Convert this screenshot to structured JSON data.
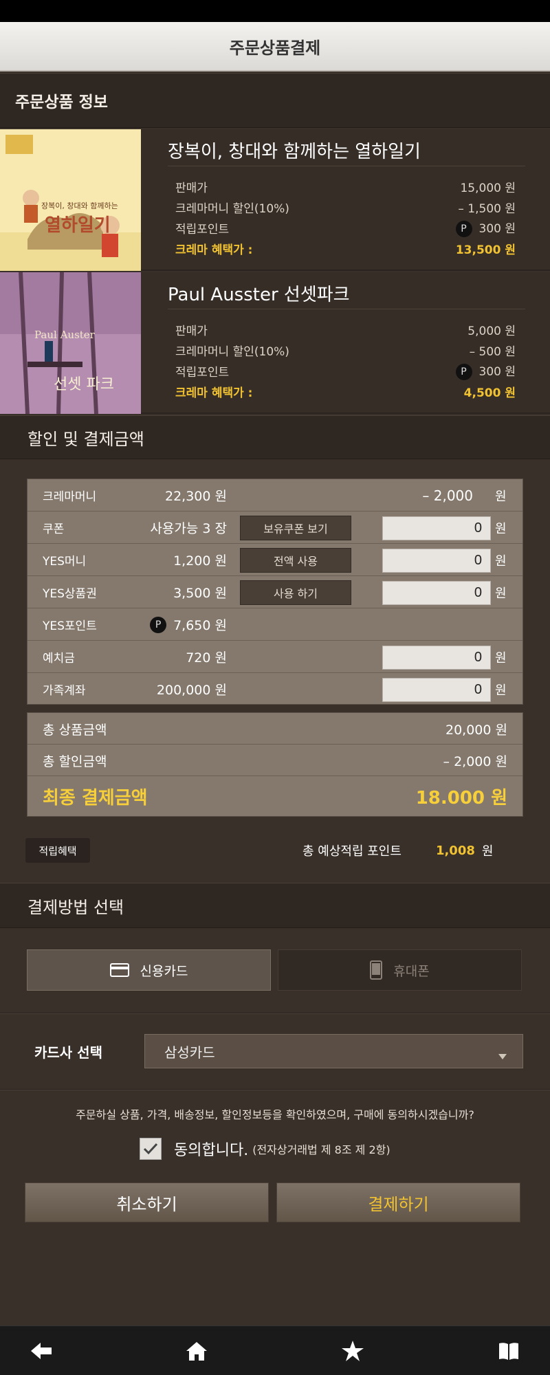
{
  "header": {
    "title": "주문상품결제"
  },
  "order_info": {
    "section_title": "주문상품 정보",
    "products": [
      {
        "name": "장복이, 창대와 함께하는 열하일기",
        "cover_title": "열하일기",
        "cover_subtitle": "장복이, 창대와 함께하는",
        "rows": [
          {
            "label": "판매가",
            "value": "15,000 원"
          },
          {
            "label": "크레마머니 할인(10%)",
            "value": "– 1,500 원"
          },
          {
            "label": "적립포인트",
            "value": "300 원",
            "badge": "P"
          },
          {
            "label": "크레마 혜택가 :",
            "value": "13,500 원"
          }
        ]
      },
      {
        "name": "Paul Ausster 선셋파크",
        "cover_title": "선셋 파크",
        "cover_subtitle": "Paul Auster",
        "rows": [
          {
            "label": "판매가",
            "value": "5,000 원"
          },
          {
            "label": "크레마머니 할인(10%)",
            "value": "– 500 원"
          },
          {
            "label": "적립포인트",
            "value": "300 원",
            "badge": "P"
          },
          {
            "label": "크레마 혜택가 :",
            "value": "4,500 원"
          }
        ]
      }
    ]
  },
  "discount": {
    "section_title": "할인 및 결제금액",
    "rows": [
      {
        "label": "크레마머니",
        "balance": "22,300 원",
        "discount": "– 2,000",
        "unit": "원"
      },
      {
        "label": "쿠폰",
        "balance": "사용가능 3 장",
        "button": "보유쿠폰 보기",
        "input": "0",
        "unit": "원"
      },
      {
        "label": "YES머니",
        "balance": "1,200 원",
        "button": "전액 사용",
        "input": "0",
        "unit": "원"
      },
      {
        "label": "YES상품권",
        "balance": "3,500 원",
        "button": "사용 하기",
        "input": "0",
        "unit": "원"
      },
      {
        "label": "YES포인트",
        "balance": "7,650 원",
        "badge": "P"
      },
      {
        "label": "예치금",
        "balance": "720 원",
        "input": "0",
        "unit": "원"
      },
      {
        "label": "가족계좌",
        "balance": "200,000 원",
        "input": "0",
        "unit": "원"
      }
    ],
    "summary": {
      "total_label": "총 상품금액",
      "total_value": "20,000 원",
      "discount_label": "총 할인금액",
      "discount_value": "– 2,000 원",
      "final_label": "최종 결제금액",
      "final_value": "18.000 원"
    },
    "benefit_tag": "적립혜택",
    "expected_points_label": "총 예상적립 포인트",
    "expected_points_value": "1,008",
    "expected_points_unit": "원"
  },
  "payment": {
    "section_title": "결제방법 선택",
    "methods": [
      {
        "label": "신용카드",
        "icon": "credit-card-icon",
        "selected": true
      },
      {
        "label": "휴대폰",
        "icon": "mobile-phone-icon",
        "selected": false
      }
    ],
    "card_select_label": "카드사 선택",
    "card_selected": "삼성카드"
  },
  "agreement": {
    "notice": "주문하실 상품, 가격, 배송정보, 할인정보등을 확인하였으며, 구매에 동의하시겠습니까?",
    "agree_label": "동의합니다.",
    "agree_note": "(전자상거래법 제 8조 제 2항)",
    "checked": true
  },
  "actions": {
    "cancel": "취소하기",
    "pay": "결제하기"
  },
  "bottom_nav": [
    "back-icon",
    "home-icon",
    "star-icon",
    "book-icon"
  ],
  "colors": {
    "accent": "#f1c232",
    "panel": "#85796d",
    "background": "#3a302a"
  }
}
